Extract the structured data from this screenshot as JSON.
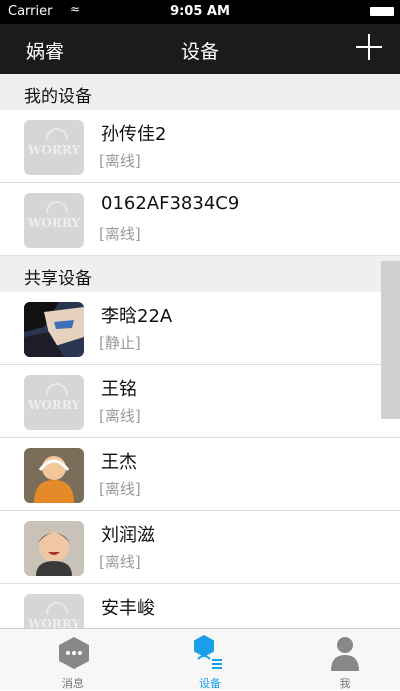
{
  "status_bar": {
    "carrier": "Carrier",
    "time": "9:05 AM"
  },
  "nav": {
    "left": "娲睿",
    "title": "设备"
  },
  "sections": {
    "mine": "我的设备",
    "shared": "共享设备"
  },
  "my_devices": [
    {
      "name": "孙传佳2",
      "status": "[离线]",
      "avatar": "worry-logo"
    },
    {
      "name": "0162AF3834C9",
      "status": "[离线]",
      "avatar": "worry-logo"
    }
  ],
  "shared_devices": [
    {
      "name": "李晗22A",
      "status": "[静止]",
      "avatar": "anime-character"
    },
    {
      "name": "王铭",
      "status": "[离线]",
      "avatar": "worry-logo"
    },
    {
      "name": "王杰",
      "status": "[离线]",
      "avatar": "cartoon-figure"
    },
    {
      "name": "刘润滋",
      "status": "[离线]",
      "avatar": "child-photo"
    },
    {
      "name": "安丰峻",
      "status": "",
      "avatar": "worry-logo"
    }
  ],
  "worry_logo_text": "WORRY",
  "tabs": [
    {
      "label": "消息",
      "icon": "chat-icon"
    },
    {
      "label": "设备",
      "icon": "device-icon"
    },
    {
      "label": "我",
      "icon": "person-icon"
    }
  ],
  "colors": {
    "navbar": "#1b1b1b",
    "section_bg": "#efeff0",
    "active_tab": "#1aa0e8"
  }
}
